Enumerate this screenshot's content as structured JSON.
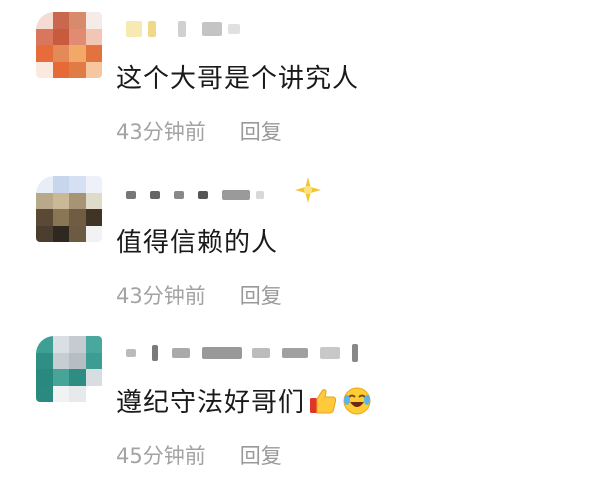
{
  "comments": [
    {
      "text": "这个大哥是个讲究人",
      "time": "43分钟前",
      "reply": "回复"
    },
    {
      "text": "值得信赖的人",
      "time": "43分钟前",
      "reply": "回复"
    },
    {
      "text": "遵纪守法好哥们",
      "time": "45分钟前",
      "reply": "回复"
    }
  ],
  "icons": {
    "comment3_emojis": [
      "thumbs-up-icon",
      "tears-of-joy-icon"
    ],
    "comment2_badge": "sparkle-icon"
  },
  "colors": {
    "text": "#1a1a1a",
    "meta": "#a3a3a3"
  }
}
